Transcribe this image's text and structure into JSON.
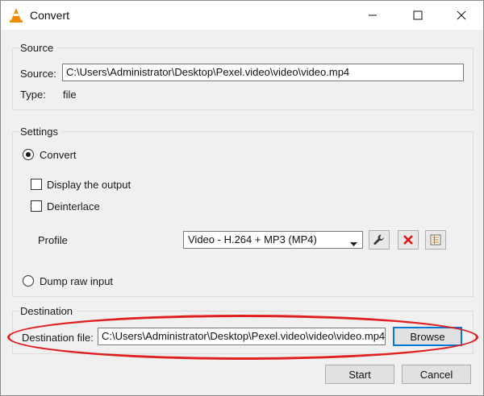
{
  "window": {
    "title": "Convert",
    "icon": "vlc-cone-icon",
    "controls": {
      "minimize": "minimize-icon",
      "maximize": "maximize-icon",
      "close": "close-icon"
    }
  },
  "source": {
    "group_title": "Source",
    "source_label": "Source:",
    "source_value": "C:\\Users\\Administrator\\Desktop\\Pexel.video\\video\\video.mp4",
    "type_label": "Type:",
    "type_value": "file"
  },
  "settings": {
    "group_title": "Settings",
    "convert_label": "Convert",
    "convert_selected": true,
    "display_output_label": "Display the output",
    "display_output_checked": false,
    "deinterlace_label": "Deinterlace",
    "deinterlace_checked": false,
    "profile_label": "Profile",
    "profile_value": "Video - H.264 + MP3 (MP4)",
    "profile_buttons": [
      "wrench-icon",
      "delete-icon",
      "new-profile-icon"
    ],
    "dump_raw_label": "Dump raw input",
    "dump_raw_selected": false
  },
  "destination": {
    "group_title": "Destination",
    "file_label": "Destination file:",
    "file_value": "C:\\Users\\Administrator\\Desktop\\Pexel.video\\video\\video.mp4",
    "browse_label": "Browse",
    "highlight_color": "#e02020"
  },
  "footer": {
    "start_label": "Start",
    "cancel_label": "Cancel"
  }
}
